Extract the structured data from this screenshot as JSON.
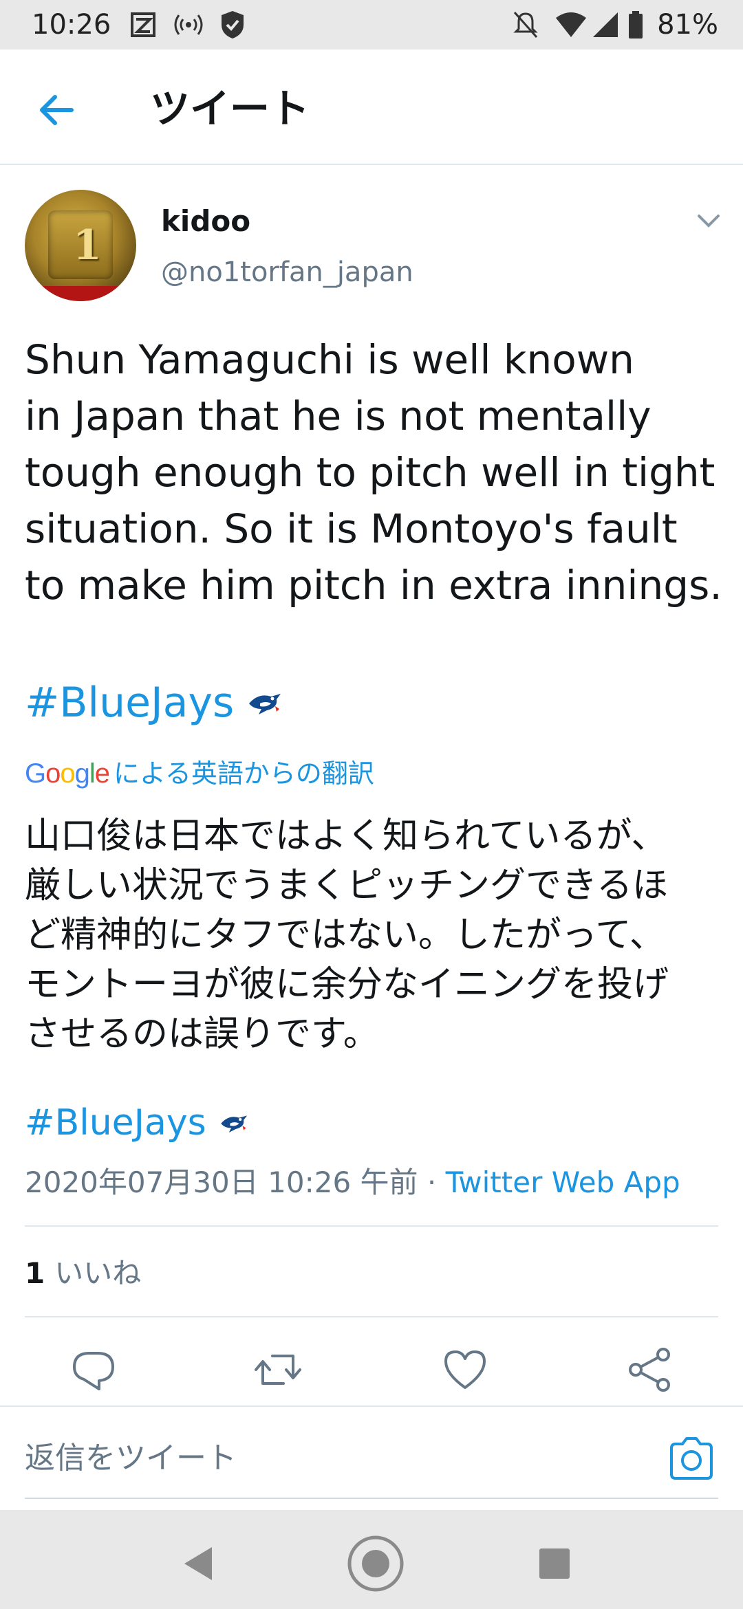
{
  "status_bar": {
    "time": "10:26",
    "battery_percent": "81%",
    "icons": [
      "app-notification-icon",
      "broadcast-icon",
      "shield-icon",
      "mute-icon",
      "wifi-icon",
      "cell-signal-icon",
      "battery-icon"
    ]
  },
  "header": {
    "back_icon": "back-arrow-icon",
    "title": "ツイート"
  },
  "tweet": {
    "author_name": "kidoo",
    "author_handle": "@no1torfan_japan",
    "text": "Shun Yamaguchi is well known\nin Japan that he is not mentally\ntough enough to pitch well in tight\nsituation. So it is Montoyo's fault\nto make him pitch in extra innings.",
    "hashtag": "#BlueJays",
    "translation_provider": "Google",
    "translation_label": "による英語からの翻訳",
    "translated_text": "山口俊は日本ではよく知られているが、\n厳しい状況でうまくピッチングできるほ\nど精神的にタフではない。したがって、\nモントーヨが彼に余分なイニングを投げ\nさせるのは誤りです。",
    "translated_hashtag": "#BlueJays",
    "timestamp": "2020年07月30日 10:26 午前 · ",
    "source": "Twitter Web App",
    "likes_count": "1",
    "likes_label": "いいね"
  },
  "actions": [
    "reply-icon",
    "retweet-icon",
    "like-icon",
    "share-icon"
  ],
  "reply": {
    "placeholder": "返信をツイート",
    "camera_icon": "camera-icon"
  },
  "nav_bar": [
    "back-triangle-icon",
    "home-circle-icon",
    "recents-square-icon"
  ],
  "colors": {
    "accent": "#1b95e0",
    "secondary_text": "#657786",
    "divider": "#e1e8ed"
  }
}
